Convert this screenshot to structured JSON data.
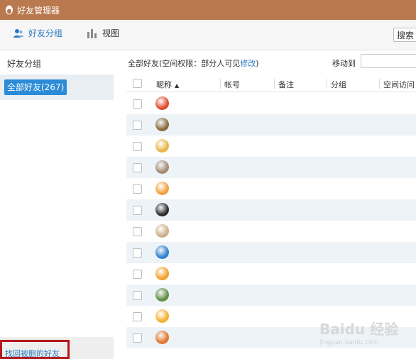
{
  "window": {
    "title": "好友管理器"
  },
  "toolbar": {
    "friends_group_label": "好友分组",
    "view_label": "视图",
    "search_label": "搜索"
  },
  "sidebar": {
    "header": "好友分组",
    "selected_group": "全部好友(267)",
    "recover_link": "找回被删的好友"
  },
  "main": {
    "info_prefix": "全部好友(空间权限：部分人可见",
    "info_edit": "修改",
    "info_suffix": ")",
    "move_to_label": "移动到"
  },
  "table": {
    "columns": [
      "昵称",
      "帐号",
      "备注",
      "分组",
      "空间访问"
    ]
  },
  "rows": [
    {
      "avatar": "penguin-avatar",
      "color": "#e04a2a"
    },
    {
      "avatar": "character-avatar",
      "color": "#8a6b3a"
    },
    {
      "avatar": "cartoon-avatar",
      "color": "#e8b64a"
    },
    {
      "avatar": "brown-avatar",
      "color": "#a58a73"
    },
    {
      "avatar": "orange-avatar",
      "color": "#f0a23a"
    },
    {
      "avatar": "penguin-avatar",
      "color": "#2a2a2a"
    },
    {
      "avatar": "beige-avatar",
      "color": "#cbb08a"
    },
    {
      "avatar": "blue-avatar",
      "color": "#2f7fd0"
    },
    {
      "avatar": "smiley-avatar",
      "color": "#f2a12b"
    },
    {
      "avatar": "green-avatar",
      "color": "#5f8f3f"
    },
    {
      "avatar": "yellow-avatar",
      "color": "#f4b233"
    },
    {
      "avatar": "clock-avatar",
      "color": "#e2762a"
    }
  ],
  "watermark": {
    "text": "Baidu 经验",
    "sub": "jingyan.baidu.com"
  }
}
